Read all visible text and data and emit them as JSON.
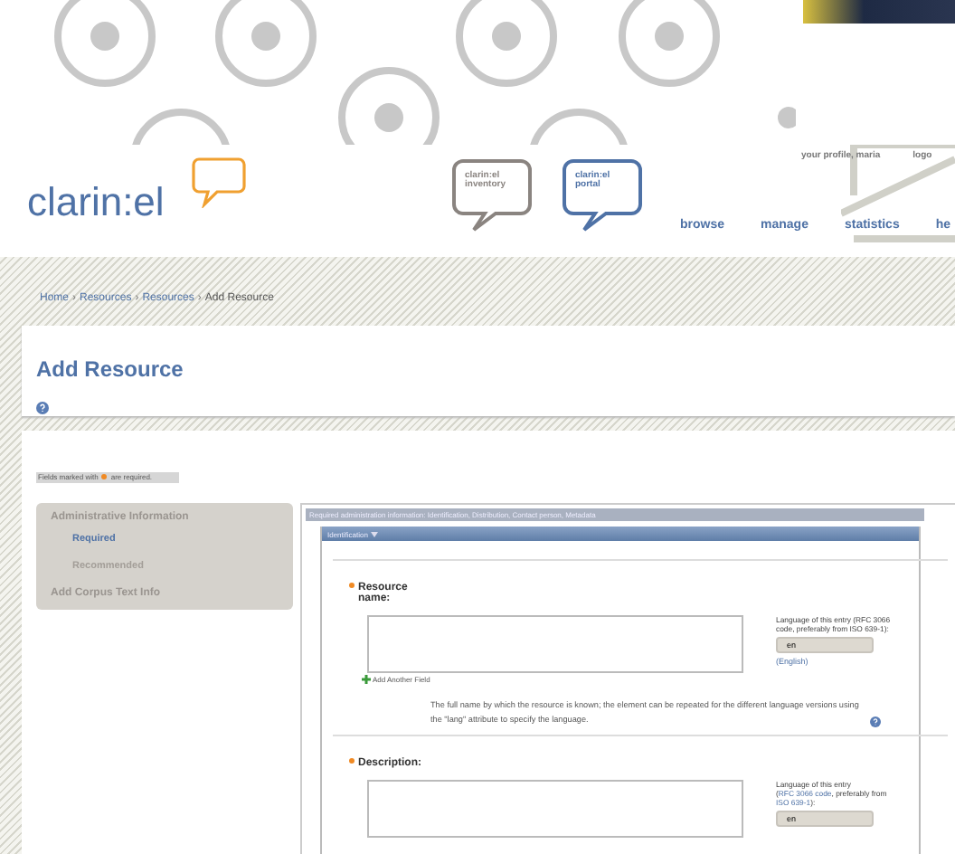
{
  "header": {
    "user_link": "your profile, maria",
    "logout_link": "logo",
    "logo": "clarin:el",
    "bubbles": [
      {
        "line1": "clarin:el",
        "line2": "inventory",
        "color": "#8a8480"
      },
      {
        "line1": "clarin:el",
        "line2": "portal",
        "color": "#4f72a6"
      }
    ],
    "nav": [
      "browse",
      "manage",
      "statistics",
      "he"
    ]
  },
  "breadcrumb": [
    {
      "label": "Home",
      "current": false,
      "sep": "›"
    },
    {
      "label": "Resources",
      "current": false,
      "sep": "›"
    },
    {
      "label": "Resources",
      "current": false,
      "sep": "›"
    },
    {
      "label": "Add Resource",
      "current": true
    }
  ],
  "title": "Add Resource",
  "required_note": {
    "before": "Fields marked with",
    "after": "are required."
  },
  "sidebar": [
    {
      "label": "Administrative Information",
      "kind": "heading",
      "selected": false
    },
    {
      "label": "Required",
      "kind": "sub",
      "selected": true
    },
    {
      "label": "Recommended",
      "kind": "sub",
      "selected": false
    },
    {
      "label": "Add Corpus Text Info",
      "kind": "heading",
      "selected": false
    }
  ],
  "form": {
    "section_bar": "Required administration information: Identification, Distribution, Contact person, Metadata",
    "group": "Identification",
    "fields": [
      {
        "label": "Resource name:",
        "required": true,
        "lang_label": [
          {
            "text": "Language of this entry (RFC 3066 code, preferably from ISO 639-1):",
            "link": false
          }
        ],
        "lang_value": "en",
        "lang_name": "(English)",
        "add_link": "Add Another Field",
        "help": "The full name by which the resource is known; the element can be repeated for the different language versions using the \"lang\" attribute to specify the language."
      },
      {
        "label": "Description:",
        "required": true,
        "lang_label": [
          {
            "text": "Language of this entry (",
            "link": false
          },
          {
            "text": "RFC 3066 code",
            "link": true
          },
          {
            "text": ", preferably from ",
            "link": false
          },
          {
            "text": "ISO 639-1",
            "link": true
          },
          {
            "text": "):",
            "link": false
          }
        ],
        "lang_value": "en"
      }
    ]
  }
}
